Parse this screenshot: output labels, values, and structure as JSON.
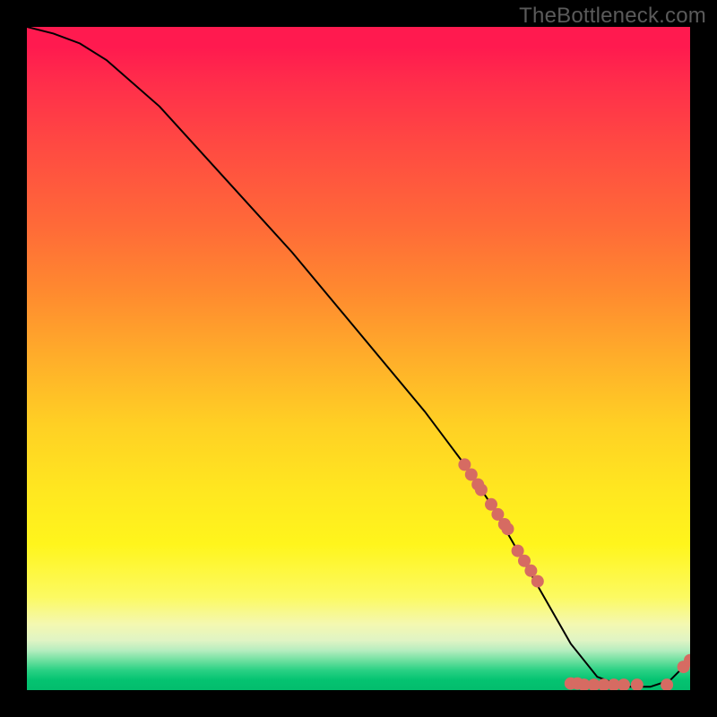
{
  "watermark": "TheBottleneck.com",
  "chart_data": {
    "type": "line",
    "title": "",
    "xlabel": "",
    "ylabel": "",
    "xlim": [
      0,
      100
    ],
    "ylim": [
      0,
      100
    ],
    "series": [
      {
        "name": "curve",
        "x": [
          0,
          4,
          8,
          12,
          20,
          30,
          40,
          50,
          60,
          66,
          70,
          74,
          78,
          82,
          86,
          90,
          94,
          97,
          100
        ],
        "values": [
          100,
          99,
          97.5,
          95,
          88,
          77,
          66,
          54,
          42,
          34,
          28,
          21,
          14,
          7,
          2,
          0.5,
          0.5,
          1.5,
          4.5
        ]
      }
    ],
    "marker_clusters": [
      {
        "name": "upper-diagonal",
        "points_xy": [
          [
            66,
            34
          ],
          [
            67,
            32.5
          ],
          [
            68,
            31
          ],
          [
            68.5,
            30.2
          ],
          [
            70,
            28
          ],
          [
            71,
            26.5
          ],
          [
            72,
            25
          ],
          [
            72.5,
            24.3
          ],
          [
            74,
            21
          ],
          [
            75,
            19.5
          ],
          [
            76,
            18
          ],
          [
            77,
            16.4
          ]
        ]
      },
      {
        "name": "bottom-row",
        "points_xy": [
          [
            82,
            1
          ],
          [
            83,
            1
          ],
          [
            84,
            0.8
          ],
          [
            85.5,
            0.8
          ],
          [
            87,
            0.8
          ],
          [
            88.5,
            0.8
          ],
          [
            90,
            0.8
          ],
          [
            92,
            0.8
          ],
          [
            96.5,
            0.8
          ]
        ]
      },
      {
        "name": "right-tail",
        "points_xy": [
          [
            99,
            3.5
          ],
          [
            100,
            4.5
          ]
        ]
      }
    ],
    "marker_color": "#d66b62",
    "line_color": "#000000"
  }
}
